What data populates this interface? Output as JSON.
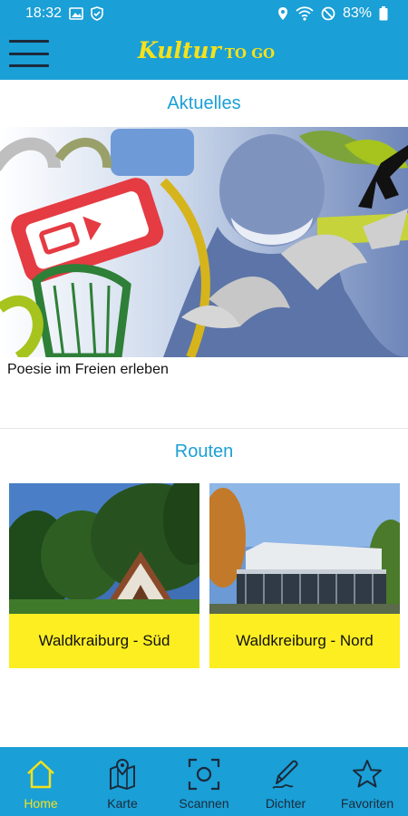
{
  "status_bar": {
    "time": "18:32",
    "battery": "83%",
    "icons": [
      "gallery-icon",
      "vpn-shield-icon",
      "location-icon",
      "wifi-icon",
      "dnd-icon",
      "battery-icon"
    ]
  },
  "header": {
    "menu_icon": "hamburger-menu-icon",
    "brand_main": "Kultur",
    "brand_sub": "TO GO"
  },
  "news": {
    "title": "Aktuelles",
    "items": [
      {
        "caption": "Poesie im Freien erleben"
      }
    ]
  },
  "routes": {
    "title": "Routen",
    "cards": [
      {
        "label": "Waldkraiburg - Süd"
      },
      {
        "label": "Waldkreiburg - Nord"
      }
    ]
  },
  "bottom_nav": {
    "items": [
      {
        "label": "Home",
        "icon": "home-icon",
        "active": true
      },
      {
        "label": "Karte",
        "icon": "map-icon",
        "active": false
      },
      {
        "label": "Scannen",
        "icon": "scan-icon",
        "active": false
      },
      {
        "label": "Dichter",
        "icon": "pen-icon",
        "active": false
      },
      {
        "label": "Favoriten",
        "icon": "star-icon",
        "active": false
      }
    ]
  },
  "colors": {
    "primary": "#1a9fd6",
    "accent": "#f5e11c",
    "card_label_bg": "#fcee21",
    "nav_text": "#1b2a3a"
  }
}
